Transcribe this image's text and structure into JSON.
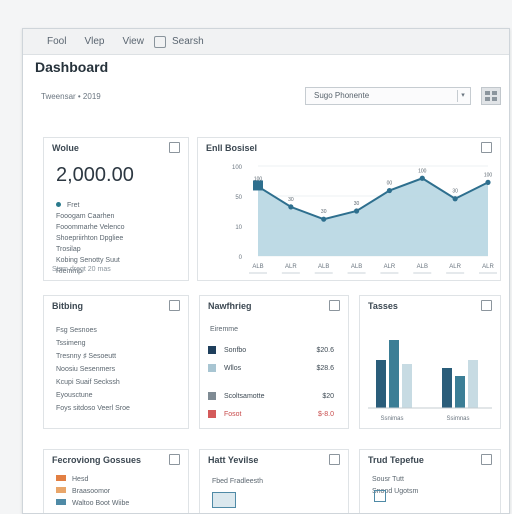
{
  "menu": {
    "items": [
      "Fool",
      "Vlep",
      "View",
      "Searsh"
    ]
  },
  "page_title": "Dashboard",
  "toolbar": {
    "date_range": "Tweensar • 2019",
    "select_value": "Sugo Phonente"
  },
  "card_value": {
    "title": "Wolue",
    "value": "2,000.00",
    "legend": "Fret",
    "lines": [
      "Fooogam Caarhen",
      "Fooommarhe Velenco",
      "Shoepriirhton Dpgliee",
      "Trosilap",
      "Kobing Senotty Suut",
      "Rlemmp"
    ],
    "footer": "Stsm dregt 20 mas"
  },
  "card_trend": {
    "title": "Enll Bosisel",
    "chart_data": {
      "type": "area",
      "x": [
        "ALB",
        "ALR",
        "ALB",
        "ALB",
        "ALR",
        "ALB",
        "ALR",
        "ALR"
      ],
      "series": [
        {
          "values": [
            85,
            60,
            45,
            55,
            80,
            95,
            70,
            90
          ]
        }
      ],
      "marker_labels": [
        "100",
        "30",
        "30",
        "30",
        "00",
        "100",
        "30",
        "100"
      ],
      "yticks": [
        "100",
        "50",
        "10",
        "0"
      ],
      "ylim": [
        0,
        110
      ]
    }
  },
  "card_billing": {
    "title": "Bitbing",
    "lines": [
      "Fsg Sesnoes",
      "Tssimeng",
      "Tresnny ♯ Sesoeutt",
      "Noosiu Sesenmers",
      "Kcupi Suaif Seckssh",
      "Eyousctune",
      "Foys sitdoso Veerl Sroe"
    ]
  },
  "card_pricing": {
    "title": "Nawfhrieg",
    "subtitle": "Eiremme",
    "rows": [
      {
        "label": "Sonfbo",
        "value": "$20.6",
        "color": "#1f3f5c"
      },
      {
        "label": "Wllos",
        "value": "$28.6",
        "color": "#a8c5d2"
      },
      {
        "label": "Scoltsamotte",
        "value": "$20",
        "color": "#7f8b94"
      },
      {
        "label": "Fosot",
        "value": "$-8.0",
        "color": "#d45a5a",
        "negative": true
      }
    ]
  },
  "card_sales": {
    "title": "Tasses",
    "chart_data": {
      "type": "bar",
      "categories": [
        "Ssnimas",
        "Ssimnas"
      ],
      "series": [
        {
          "values": [
            60,
            50
          ]
        },
        {
          "values": [
            85,
            40
          ]
        },
        {
          "values": [
            55,
            60
          ]
        }
      ],
      "ylim": [
        0,
        100
      ],
      "colors": [
        "#2a5d7a",
        "#3b7e96",
        "#c7dbe3"
      ]
    }
  },
  "card_reconciling": {
    "title": "Fecroviong Gossues",
    "items": [
      "Hesd",
      "Braasoomor",
      "Waltoo Boot Wiibe"
    ]
  },
  "card_status": {
    "title": "Hatt Yevilse",
    "line": "Fbed Fradleesth"
  },
  "card_staff": {
    "title": "Trud Tepefue",
    "lines": [
      "Sousr Tutt",
      "Snood Ugotsm"
    ]
  }
}
